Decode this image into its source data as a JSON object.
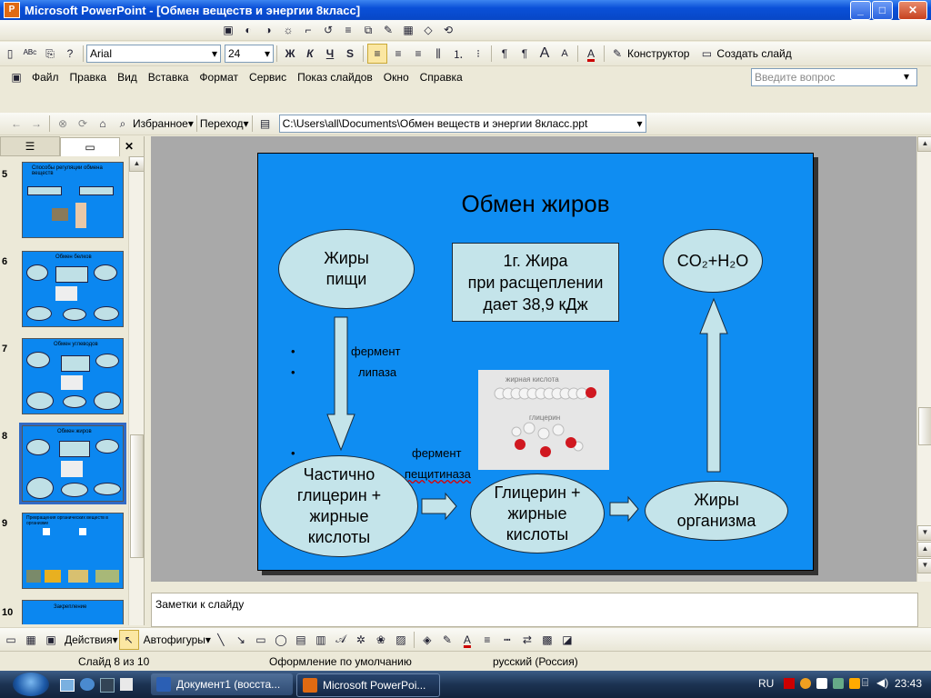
{
  "window": {
    "title": "Microsoft PowerPoint - [Обмен веществ и энергии 8класс]"
  },
  "formatting": {
    "font_name": "Arial",
    "font_size": "24",
    "bold": "Ж",
    "italic": "К",
    "underline": "Ч",
    "shadow": "S",
    "designer_label": "Конструктор",
    "new_slide_label": "Создать слайд"
  },
  "menu": {
    "items": [
      "Файл",
      "Правка",
      "Вид",
      "Вставка",
      "Формат",
      "Сервис",
      "Показ слайдов",
      "Окно",
      "Справка"
    ],
    "ask_placeholder": "Введите вопрос"
  },
  "web": {
    "favorites": "Избранное",
    "go": "Переход",
    "address": "C:\\Users\\all\\Documents\\Обмен веществ и энергии 8класс.ppt"
  },
  "thumbnails": [
    {
      "num": "5",
      "title": "Способы регуляции обмена веществ"
    },
    {
      "num": "6",
      "title": "Обмен белков"
    },
    {
      "num": "7",
      "title": "Обмен углеводов"
    },
    {
      "num": "8",
      "title": "Обмен жиров"
    },
    {
      "num": "9",
      "title": "Превращения органических веществ в организме"
    },
    {
      "num": "10",
      "title": "Закрепление"
    }
  ],
  "slide": {
    "title": "Обмен жиров",
    "food_fats": "Жиры\nпищи",
    "info_box": "1г. Жира\nпри расщеплении\nдает 38,9 кДж",
    "products": "CO₂+H₂O",
    "bullet1": "фермент",
    "bullet2": "липаза",
    "bullet3": "фермент",
    "bullet3b": "пещитиназа",
    "image_label1": "жирная кислота",
    "image_label2": "глицерин",
    "partial": "Частично\nглицерин +\nжирные\nкислоты",
    "glycerol": "Глицерин +\nжирные\nкислоты",
    "body_fats": "Жиры\nорганизма"
  },
  "notes": {
    "placeholder": "Заметки к слайду"
  },
  "drawing": {
    "actions": "Действия",
    "autoshapes": "Автофигуры"
  },
  "status": {
    "slide": "Слайд 8 из 10",
    "design": "Оформление по умолчанию",
    "language": "русский (Россия)"
  },
  "taskbar": {
    "task1": "Документ1 (восста...",
    "task2": "Microsoft PowerPoi...",
    "lang": "RU",
    "time": "23:43"
  },
  "colors": {
    "slide_bg": "#0f8df2",
    "shape_fill": "#c4e4ea",
    "selection": "#316ac5"
  }
}
